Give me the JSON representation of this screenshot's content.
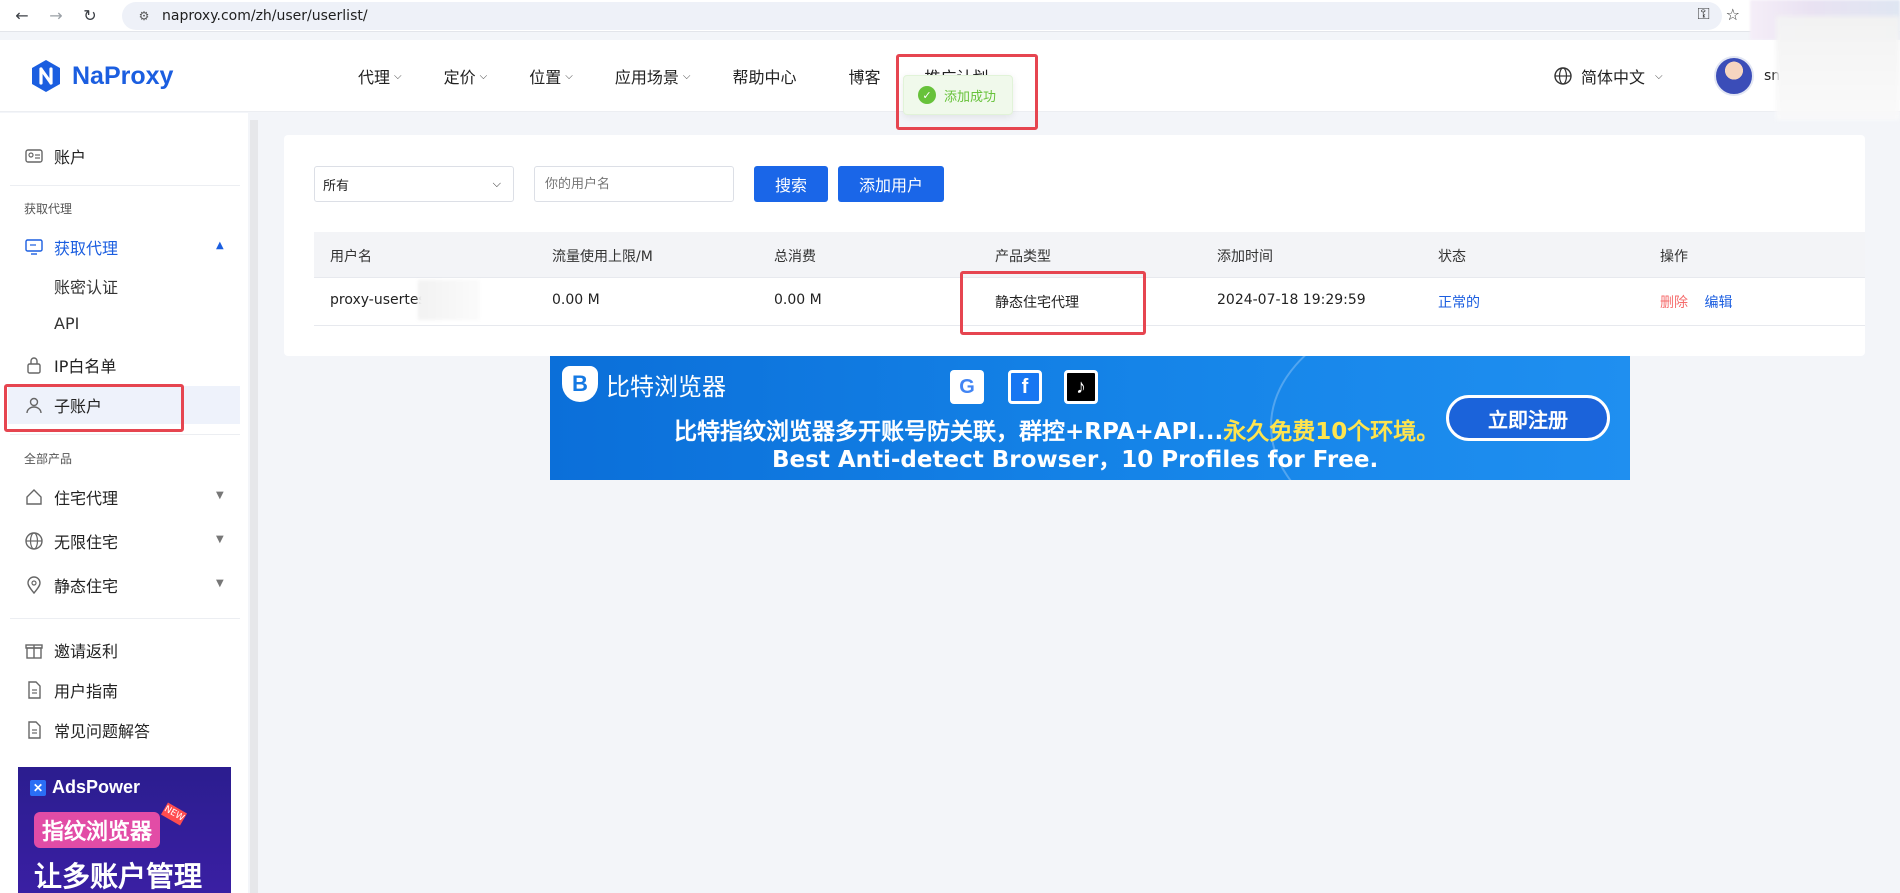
{
  "browser": {
    "url": "naproxy.com/zh/user/userlist/"
  },
  "header": {
    "logo_text": "NaProxy",
    "nav": [
      "代理",
      "定价",
      "位置",
      "应用场景",
      "帮助中心",
      "博客"
    ],
    "nav_partial": "推广计划",
    "language": "简体中文",
    "user_name": "sn"
  },
  "toast": {
    "message": "添加成功"
  },
  "sidebar": {
    "account": "账户",
    "section_get_proxy": "获取代理",
    "get_proxy": "获取代理",
    "sub_auth": "账密认证",
    "sub_api": "API",
    "ip_whitelist": "IP白名单",
    "sub_account": "子账户",
    "section_all_products": "全部产品",
    "residential": "住宅代理",
    "unlimited": "无限住宅",
    "static": "静态住宅",
    "invite": "邀请返利",
    "guide": "用户指南",
    "faq": "常见问题解答",
    "ad": {
      "brand": "AdsPower",
      "pill": "指纹浏览器",
      "badge": "NEW",
      "big": "让多账户管理"
    }
  },
  "filters": {
    "select_value": "所有",
    "username_placeholder": "你的用户名",
    "search_label": "搜索",
    "add_user_label": "添加用户"
  },
  "table": {
    "columns": [
      "用户名",
      "流量使用上限/M",
      "总消费",
      "产品类型",
      "添加时间",
      "状态",
      "操作"
    ],
    "rows": [
      {
        "username": "proxy-usertes",
        "traffic_limit": "0.00 M",
        "total_spent": "0.00 M",
        "product_type": "静态住宅代理",
        "added_time": "2024-07-18 19:29:59",
        "status": "正常的",
        "op_delete": "删除",
        "op_edit": "编辑"
      }
    ]
  },
  "banner": {
    "brand": "比特浏览器",
    "line1_main": "比特指纹浏览器多开账号防关联，群控+RPA+API...",
    "line1_highlight": "永久免费10个环境。",
    "line2": "Best Anti-detect Browser，10 Profiles for Free.",
    "cta": "立即注册",
    "shield_letter": "B",
    "social": [
      "G",
      "f",
      "♪"
    ]
  },
  "colors": {
    "primary": "#1a66e8",
    "danger": "#f56c6c",
    "success": "#67c23a",
    "annotation": "#e64550"
  }
}
